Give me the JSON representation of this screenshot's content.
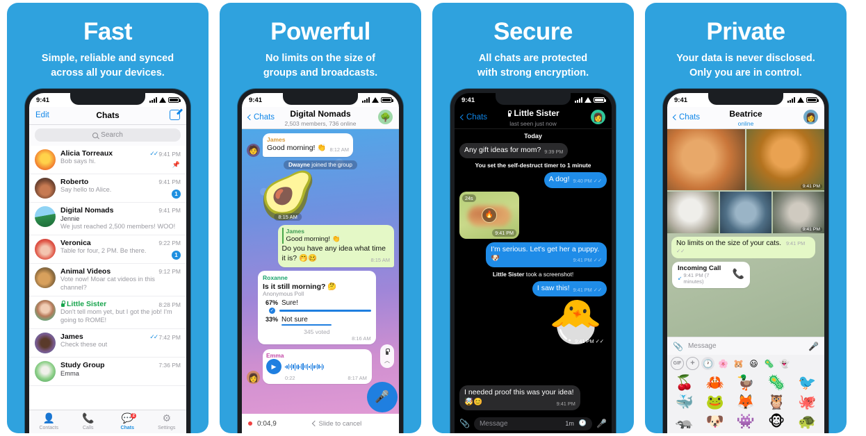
{
  "theme": {
    "panel_bg": "#2FA2DE",
    "accent_blue": "#1F90E0",
    "out_bubble_green": "#E4F8C6",
    "dark_bg": "#000000"
  },
  "panels": [
    {
      "headline": "Fast",
      "subline_1": "Simple, reliable and synced",
      "subline_2": "across all your devices.",
      "phone": {
        "status_time": "9:41",
        "nav": {
          "left": "Edit",
          "title": "Chats",
          "right_icon": "compose-icon"
        },
        "search_placeholder": "Search",
        "chats": [
          {
            "name": "Alicia Torreaux",
            "time": "9:41 PM",
            "message": "Bob says hi.",
            "checked": true,
            "pinned": true,
            "avatar": "avatar-alicia"
          },
          {
            "name": "Roberto",
            "time": "9:41 PM",
            "message": "Say hello to Alice.",
            "badge": "1",
            "avatar": "avatar-roberto"
          },
          {
            "name": "Digital Nomads",
            "time": "9:41 PM",
            "sender": "Jennie",
            "message": "We just reached 2,500 members! WOO!",
            "avatar": "avatar-nomads"
          },
          {
            "name": "Veronica",
            "time": "9:22 PM",
            "message": "Table for four, 2 PM. Be there.",
            "badge": "1",
            "avatar": "avatar-veronica"
          },
          {
            "name": "Animal Videos",
            "time": "9:12 PM",
            "message": "Vote now! Moar cat videos in this channel?",
            "avatar": "avatar-animals"
          },
          {
            "name": "Little Sister",
            "time": "8:28 PM",
            "message": "Don't tell mom yet, but I got the job! I'm going to ROME!",
            "secure": true,
            "avatar": "avatar-sister"
          },
          {
            "name": "James",
            "time": "7:42 PM",
            "message": "Check these out",
            "checked": true,
            "avatar": "avatar-james"
          },
          {
            "name": "Study Group",
            "time": "7:36 PM",
            "sender": "Emma",
            "message": "",
            "avatar": "avatar-study"
          }
        ],
        "tabs": [
          {
            "label": "Contacts",
            "icon": "contacts-icon",
            "active": false
          },
          {
            "label": "Calls",
            "icon": "phone-icon",
            "active": false
          },
          {
            "label": "Chats",
            "icon": "chats-icon",
            "active": true,
            "badge": "2"
          },
          {
            "label": "Settings",
            "icon": "gear-icon",
            "active": false
          }
        ]
      }
    },
    {
      "headline": "Powerful",
      "subline_1": "No limits on the size of",
      "subline_2": "groups and broadcasts.",
      "phone": {
        "status_time": "9:41",
        "nav": {
          "back": "Chats",
          "title": "Digital Nomads",
          "subtitle": "2,503 members, 736 online"
        },
        "messages": [
          {
            "type": "in",
            "who": "James",
            "text": "Good morning! 👏",
            "time": "8:12 AM"
          },
          {
            "type": "service",
            "bold": "Dwayne",
            "rest": " joined the group"
          },
          {
            "type": "sticker",
            "glyph": "🥑",
            "time": "8:15 AM"
          },
          {
            "type": "out",
            "who": "James",
            "quote": "Good morning! 👏",
            "text": "Do you have any idea what time it is? 🤭🥴",
            "time": "8:15 AM"
          }
        ],
        "poll": {
          "who": "Roxanne",
          "question": "Is it still morning? 🤔",
          "kind": "Anonymous Poll",
          "options": [
            {
              "pct": "67%",
              "label": "Sure!",
              "value": 67,
              "selected": true
            },
            {
              "pct": "33%",
              "label": "Not sure",
              "value": 33,
              "selected": false
            }
          ],
          "voted": "345 voted",
          "time": "8:16 AM"
        },
        "voice": {
          "who": "Emma",
          "duration": "0:22",
          "time": "8:17 AM"
        },
        "recording": {
          "timer": "0:04,9",
          "hint": "Slide to cancel",
          "mic_icon": "mic-icon",
          "lock_icon": "lock-icon"
        }
      }
    },
    {
      "headline": "Secure",
      "subline_1": "All chats are protected",
      "subline_2": "with strong encryption.",
      "phone": {
        "status_time": "9:41",
        "nav": {
          "back": "Chats",
          "title": "Little Sister",
          "subtitle": "last seen just now",
          "lock": true
        },
        "day": "Today",
        "messages": [
          {
            "type": "in",
            "text": "Any gift ideas for mom?",
            "time": "9:39 PM"
          },
          {
            "type": "service",
            "text": "You set the self-destruct timer to 1 minute"
          },
          {
            "type": "out",
            "text": "A dog!",
            "time": "9:40 PM"
          },
          {
            "type": "photo",
            "badge": "24s",
            "time": "9:41 PM"
          },
          {
            "type": "out",
            "text": "I'm serious. Let's get her a puppy. 🐶",
            "time": "9:41 PM"
          },
          {
            "type": "service",
            "bold": "Little Sister",
            "rest": " took a screenshot!"
          },
          {
            "type": "out",
            "text": "I saw this!",
            "time": "9:41 PM"
          },
          {
            "type": "sticker",
            "glyph": "🐣",
            "time": "9:41 PM"
          },
          {
            "type": "in",
            "text": "I needed proof this was your idea! 🤯😊",
            "time": "9:41 PM"
          }
        ],
        "input": {
          "placeholder": "Message",
          "timer": "1m",
          "attach_icon": "paperclip-icon",
          "clock_icon": "clock-icon",
          "mic_icon": "mic-icon"
        }
      }
    },
    {
      "headline": "Private",
      "subline_1": "Your data is never disclosed.",
      "subline_2": "Only you are in control.",
      "phone": {
        "status_time": "9:41",
        "nav": {
          "back": "Chats",
          "title": "Beatrice",
          "subtitle": "online"
        },
        "album_times": {
          "top_right": "9:41 PM",
          "bottom_right": "9:41 PM"
        },
        "bubble": {
          "text": "No limits on the size of your cats.",
          "time": "9:41 PM"
        },
        "call": {
          "title": "Incoming Call",
          "sub": "9:41 PM (7 minutes)",
          "icon": "phone-icon"
        },
        "input": {
          "placeholder": "Message",
          "attach_icon": "paperclip-icon",
          "mic_icon": "mic-icon"
        },
        "sticker_tabs": [
          "GIF",
          "+",
          "clock-icon",
          "🌸",
          "🐹",
          "😃",
          "🦠",
          "👻"
        ],
        "stickers": [
          "🍒",
          "🦀",
          "🦆",
          "🦠",
          "🐦",
          "🐳",
          "🐸",
          "🦊",
          "🦉",
          "🐙",
          "🦡",
          "🐶",
          "👾",
          "🐵",
          "🐢"
        ]
      }
    }
  ]
}
